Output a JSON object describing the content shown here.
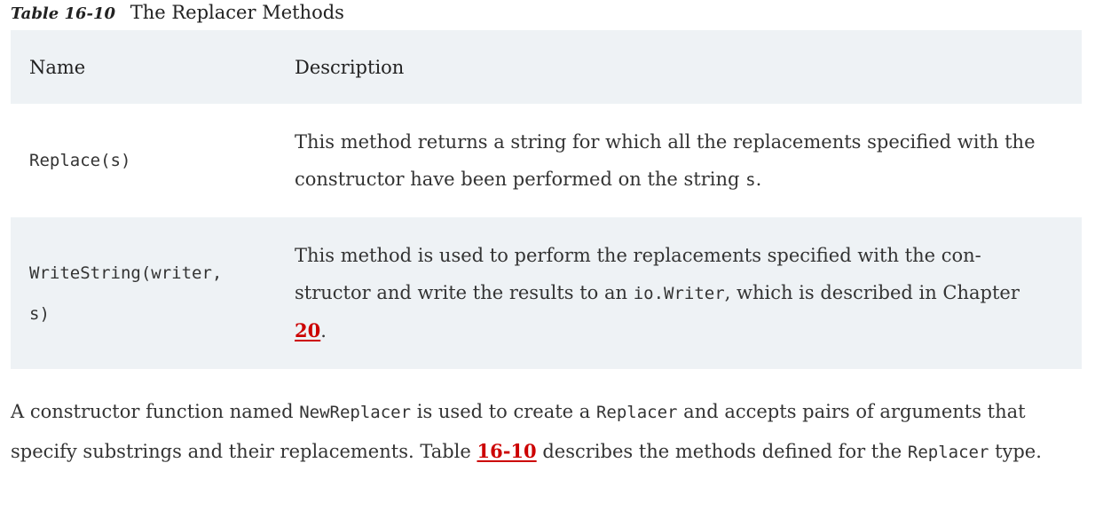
{
  "caption": {
    "label": "Table 16-10",
    "title": "The Replacer Methods"
  },
  "table": {
    "headers": [
      "Name",
      "Description"
    ],
    "rows": [
      {
        "name": "Replace(s)",
        "desc_text1": "This method returns a string for which all the replacements specified with the constructor have been performed on the string ",
        "desc_code1": "s",
        "desc_text2": "."
      },
      {
        "name_line1": "WriteString(writer,",
        "name_line2": "s)",
        "desc_text1": "This method is used to perform the replacements specified with the con-structor and write the results to an ",
        "desc_code1": "io.Writer",
        "desc_text2": ", which is described in Chapter ",
        "desc_link": "20",
        "desc_text3": "."
      }
    ]
  },
  "paragraph": {
    "t1": "A constructor function named ",
    "c1": "NewReplacer",
    "t2": " is used to create a ",
    "c2": "Replacer",
    "t3": " and accepts pairs of arguments that specify substrings and their replacements. Table ",
    "link": "16-10",
    "t4": " describes the methods defined for the ",
    "c3": "Replacer",
    "t5": " type."
  },
  "colors": {
    "link": "#cc0000",
    "band": "#eef2f5"
  }
}
